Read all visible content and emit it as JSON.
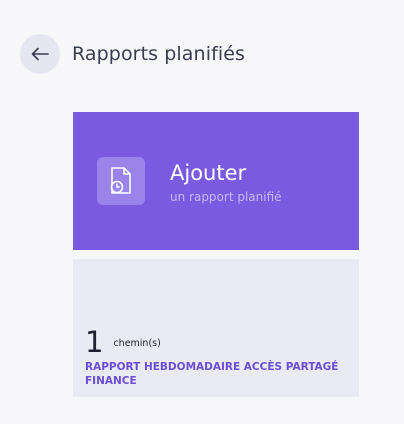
{
  "header": {
    "back_icon": "arrow-left-icon",
    "title": "Rapports planifiés"
  },
  "add_card": {
    "icon": "scheduled-report-icon",
    "title": "Ajouter",
    "subtitle": "un rapport planifié",
    "background": "#7a5ae0"
  },
  "reports": [
    {
      "count": "1",
      "count_unit": "chemin(s)",
      "name": "RAPPORT HEBDOMADAIRE ACCÈS PARTAGÉ FINANCE",
      "accent": "#6b4fd6"
    }
  ]
}
